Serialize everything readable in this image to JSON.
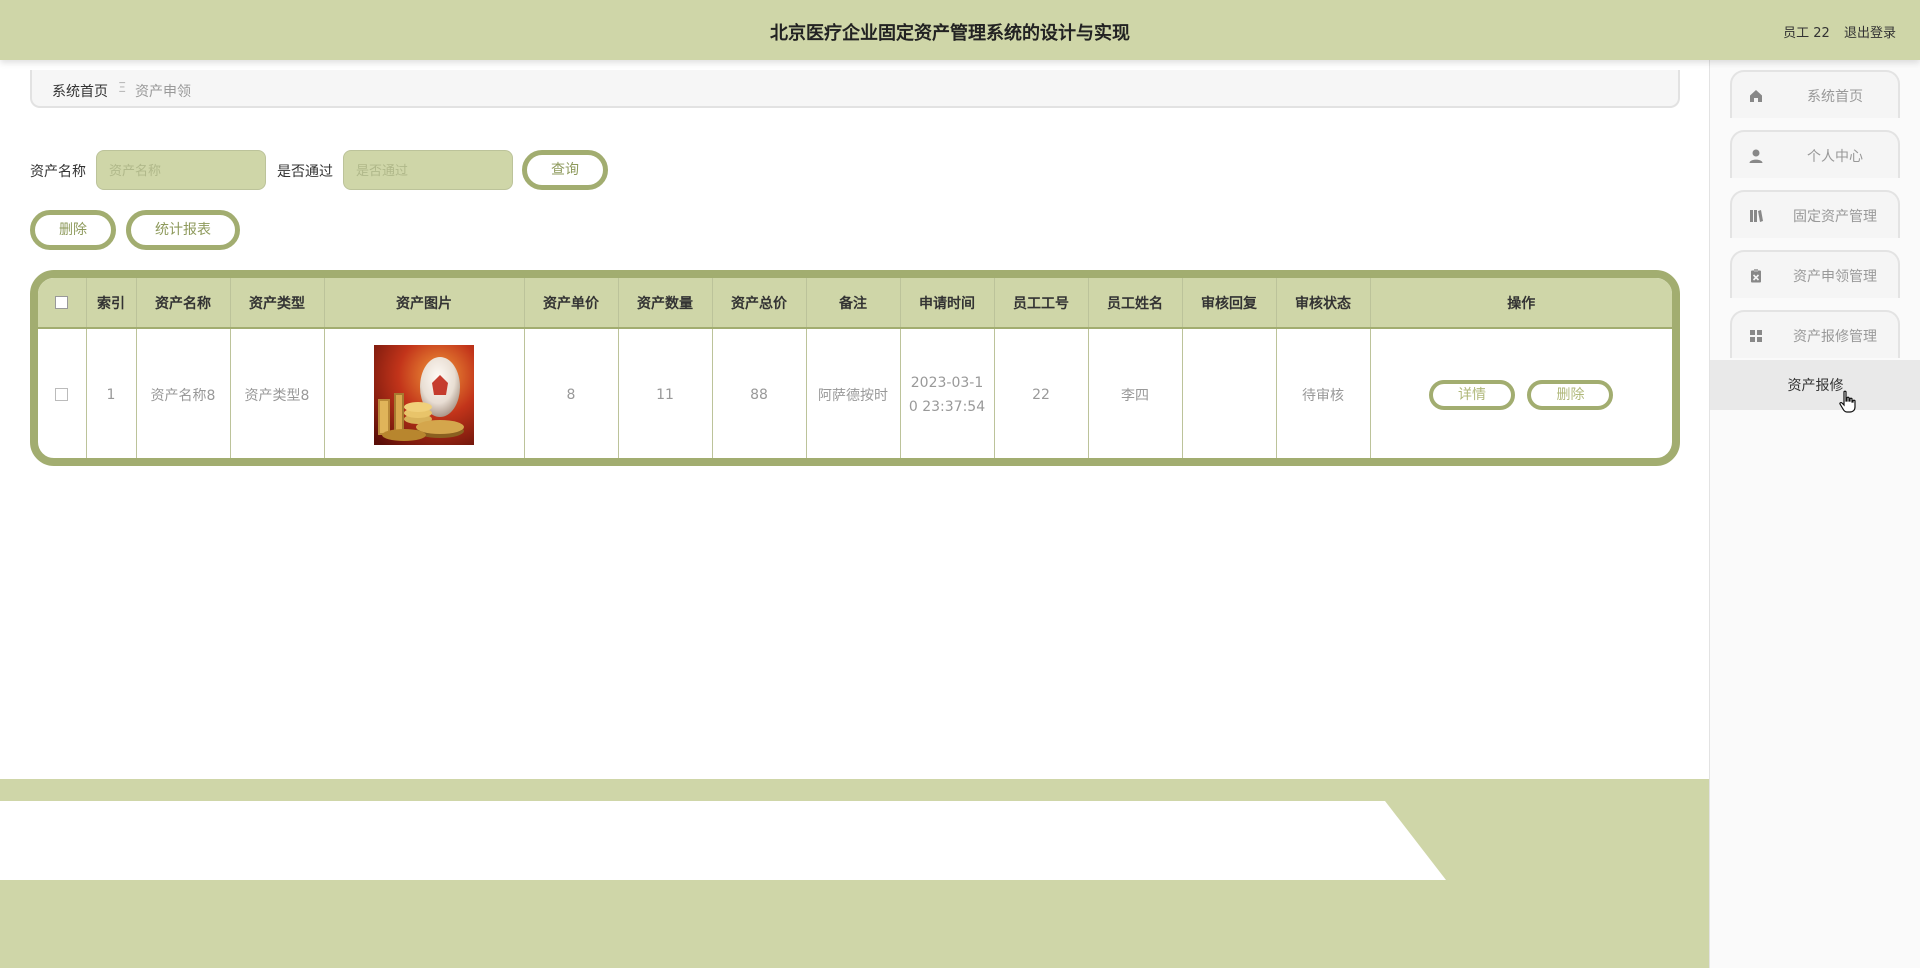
{
  "header": {
    "title": "北京医疗企业固定资产管理系统的设计与实现",
    "user_label": "员工 22",
    "logout_label": "退出登录"
  },
  "breadcrumb": {
    "home": "系统首页",
    "separator": "Ξ",
    "current": "资产申领"
  },
  "search": {
    "name_label": "资产名称",
    "name_placeholder": "资产名称",
    "pass_label": "是否通过",
    "pass_placeholder": "是否通过",
    "query_label": "查询"
  },
  "actions": {
    "delete_label": "删除",
    "report_label": "统计报表"
  },
  "table": {
    "headers": [
      "索引",
      "资产名称",
      "资产类型",
      "资产图片",
      "资产单价",
      "资产数量",
      "资产总价",
      "备注",
      "申请时间",
      "员工工号",
      "员工姓名",
      "审核回复",
      "审核状态",
      "操作"
    ],
    "rows": [
      {
        "index": "1",
        "name": "资产名称8",
        "type": "资产类型8",
        "unit_price": "8",
        "quantity": "11",
        "total": "88",
        "remark": "阿萨德按时",
        "time_line1": "2023-03-1",
        "time_line2": "0 23:37:54",
        "emp_no": "22",
        "emp_name": "李四",
        "reply": "",
        "status": "待审核",
        "detail_label": "详情",
        "delete_label": "删除"
      }
    ]
  },
  "sidebar": {
    "items": [
      {
        "label": "系统首页",
        "icon": "home-icon"
      },
      {
        "label": "个人中心",
        "icon": "user-icon"
      },
      {
        "label": "固定资产管理",
        "icon": "book-icon"
      },
      {
        "label": "资产申领管理",
        "icon": "clipboard-icon"
      },
      {
        "label": "资产报修管理",
        "icon": "grid-icon"
      }
    ],
    "sub_item": "资产报修"
  },
  "colors": {
    "primary": "#cfd6a8",
    "accent": "#a2ad70"
  }
}
